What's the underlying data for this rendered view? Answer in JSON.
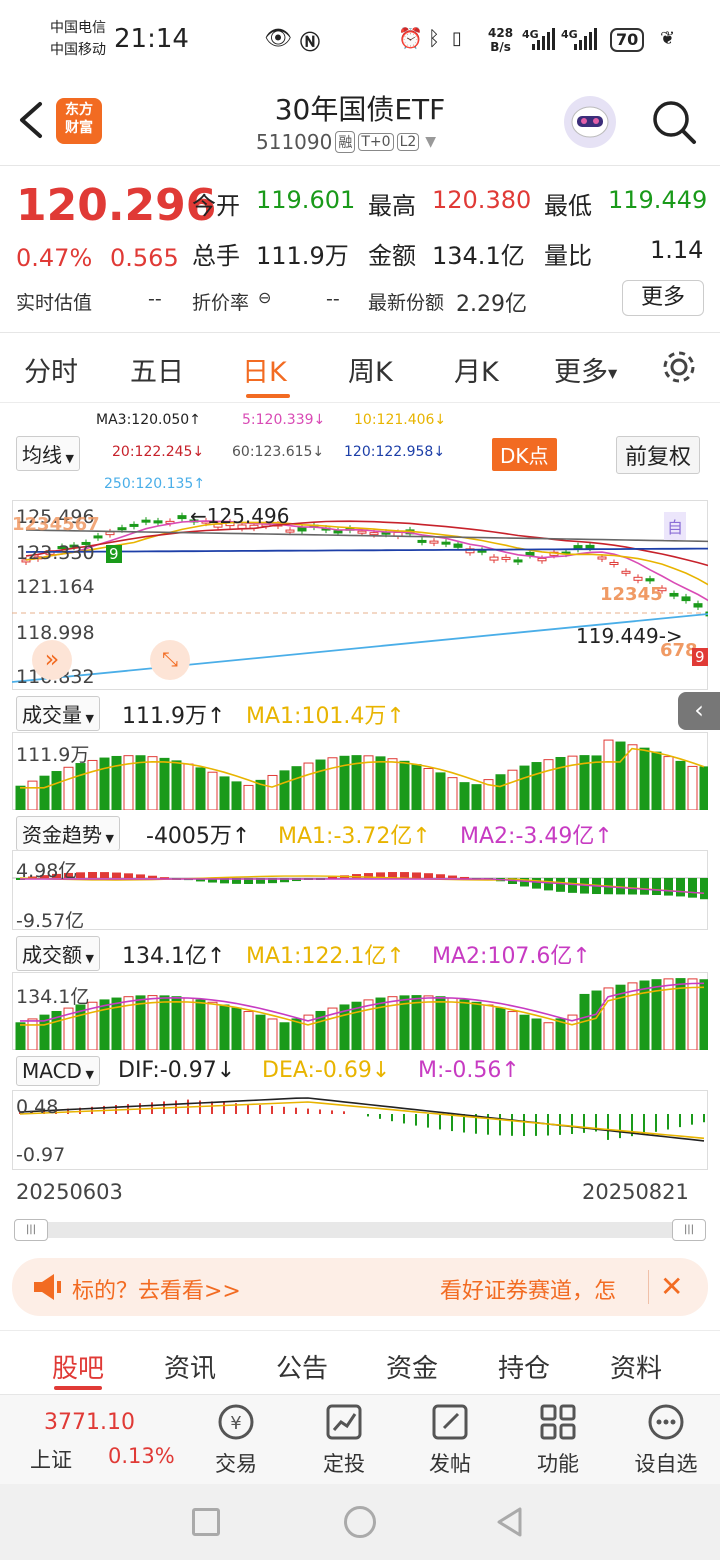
{
  "status_bar": {
    "carrier1": "中国电信",
    "carrier2": "中国移动",
    "time": "21:14",
    "net_speed_value": "428",
    "net_speed_unit": "B/s",
    "sig1": "4G",
    "sig2": "4G",
    "battery": "70"
  },
  "header": {
    "logo_line1": "东方",
    "logo_line2": "财富",
    "title": "30年国债ETF",
    "code": "511090",
    "tags": [
      "融",
      "T+0",
      "L2"
    ]
  },
  "quote": {
    "price": "120.296",
    "change_pct": "0.47%",
    "change": "0.565",
    "open_label": "今开",
    "open": "119.601",
    "high_label": "最高",
    "high": "120.380",
    "low_label": "最低",
    "low": "119.449",
    "volume_label": "总手",
    "volume": "111.9万",
    "amount_label": "金额",
    "amount": "134.1亿",
    "ratio_label": "量比",
    "ratio": "1.14",
    "iopv_label": "实时估值",
    "iopv": "--",
    "premium_label": "折价率",
    "premium": "--",
    "shares_label": "最新份额",
    "shares": "2.29亿",
    "more_label": "更多"
  },
  "tabs": [
    "分时",
    "五日",
    "日K",
    "周K",
    "月K",
    "更多"
  ],
  "active_tab": 2,
  "ma_header": {
    "ma3": "MA3:120.050↑",
    "ma5": "5:120.339↓",
    "ma10": "10:121.406↓",
    "ma20": "20:122.245↓",
    "ma60": "60:123.615↓",
    "ma120": "120:122.958↓",
    "ma250": "250:120.135↑",
    "select_label": "均线",
    "dk_label": "DK点",
    "fq_label": "前复权"
  },
  "main_chart": {
    "y_labels": [
      "125.496",
      "123.330",
      "121.164",
      "118.998",
      "116.832"
    ],
    "high_annot": "←125.496",
    "low_annot": "119.449->",
    "self_marker": "自",
    "seq_left": "1234567",
    "seq_left_nine": "9",
    "seq_right_top": "12345",
    "seq_right_bottom": "678",
    "seq_right_nine": "9"
  },
  "volume_panel": {
    "label": "成交量",
    "value": "111.9万↑",
    "ma1": "MA1:101.4万↑",
    "axis": "111.9万"
  },
  "fund_panel": {
    "label": "资金趋势",
    "value": "-4005万↑",
    "ma1": "MA1:-3.72亿↑",
    "ma2": "MA2:-3.49亿↑",
    "axis_top": "4.98亿",
    "axis_bottom": "-9.57亿"
  },
  "amount_panel": {
    "label": "成交额",
    "value": "134.1亿↑",
    "ma1": "MA1:122.1亿↑",
    "ma2": "MA2:107.6亿↑",
    "axis": "134.1亿"
  },
  "macd_panel": {
    "label": "MACD",
    "dif": "DIF:-0.97↓",
    "dea": "DEA:-0.69↓",
    "m": "M:-0.56↑",
    "axis_top": "0.48",
    "axis_bottom": "-0.97"
  },
  "dates": {
    "start": "20250603",
    "end": "20250821"
  },
  "banner": {
    "left": "标的？去看看>>",
    "right": "看好证券赛道，怎"
  },
  "bottom_tabs": [
    "股吧",
    "资讯",
    "公告",
    "资金",
    "持仓",
    "资料"
  ],
  "active_bottom_tab": 0,
  "index": {
    "value": "3771.10",
    "name": "上证",
    "change": "0.13%"
  },
  "nav": [
    "交易",
    "定投",
    "发帖",
    "功能",
    "设自选"
  ],
  "colors": {
    "up": "#e03a36",
    "down": "#1a9a1a",
    "accent": "#f26b22"
  }
}
